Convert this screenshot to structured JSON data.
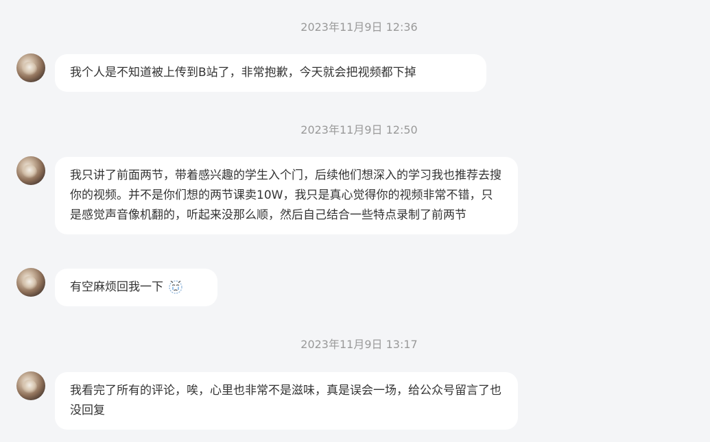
{
  "conversation": {
    "messages": [
      {
        "timestamp": "2023年11月9日 12:36",
        "text": "我个人是不知道被上传到B站了，非常抱歉，今天就会把视频都下掉"
      },
      {
        "timestamp": "2023年11月9日 12:50",
        "text": "我只讲了前面两节，带着感兴趣的学生入个门，后续他们想深入的学习我也推荐去搜你的视频。并不是你们想的两节课卖10W，我只是真心觉得你的视频非常不错，只是感觉声音像机翻的，听起来没那么顺，然后自己结合一些特点录制了前两节"
      },
      {
        "text": "有空麻烦回我一下",
        "emoji": "crying-face-icon"
      },
      {
        "timestamp": "2023年11月9日 13:17",
        "text": "我看完了所有的评论，唉，心里也非常不是滋味，真是误会一场，给公众号留言了也没回复"
      }
    ]
  },
  "colors": {
    "background": "#f4f5f7",
    "bubble": "#ffffff",
    "timestamp_text": "#999999",
    "message_text": "#333333"
  }
}
